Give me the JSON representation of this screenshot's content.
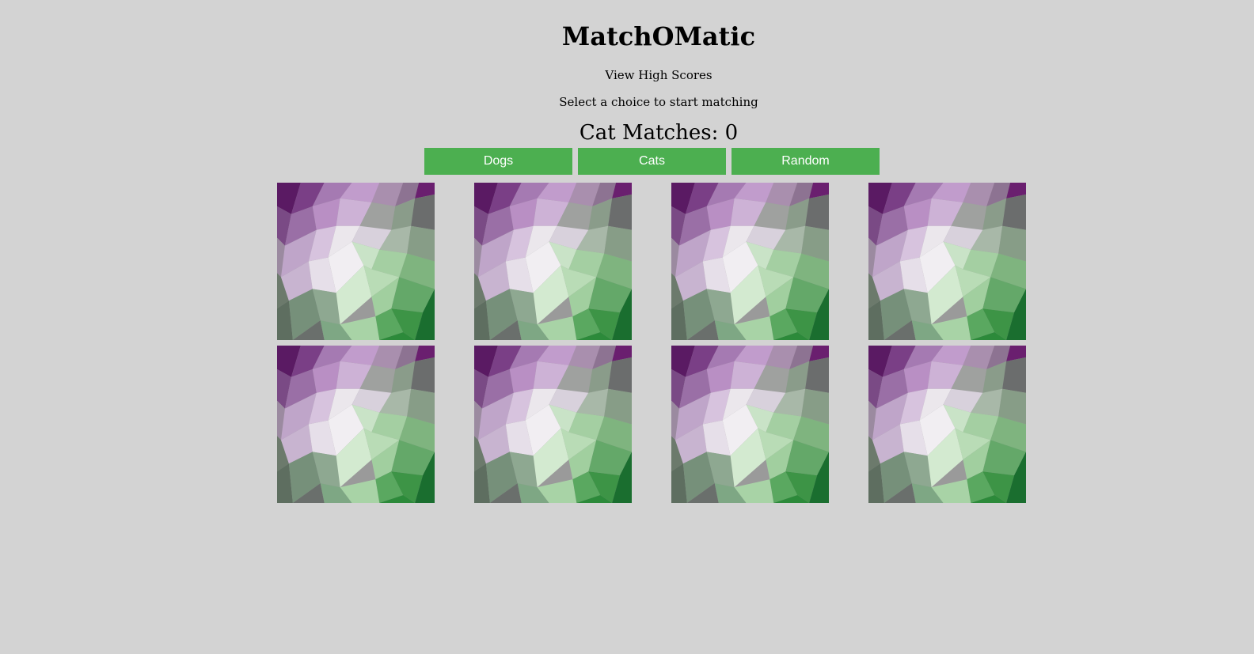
{
  "header": {
    "title": "MatchOMatic",
    "high_scores_link": "View High Scores",
    "instructions": "Select a choice to start matching",
    "score_text": "Cat Matches: 0"
  },
  "choices": [
    {
      "label": "Dogs"
    },
    {
      "label": "Cats"
    },
    {
      "label": "Random"
    }
  ],
  "cards": {
    "count": 8,
    "face": "face-down",
    "pattern": "low-poly-purple-green"
  },
  "colors": {
    "background": "#d3d3d3",
    "button": "#4caf50",
    "button_text": "#ffffff"
  }
}
